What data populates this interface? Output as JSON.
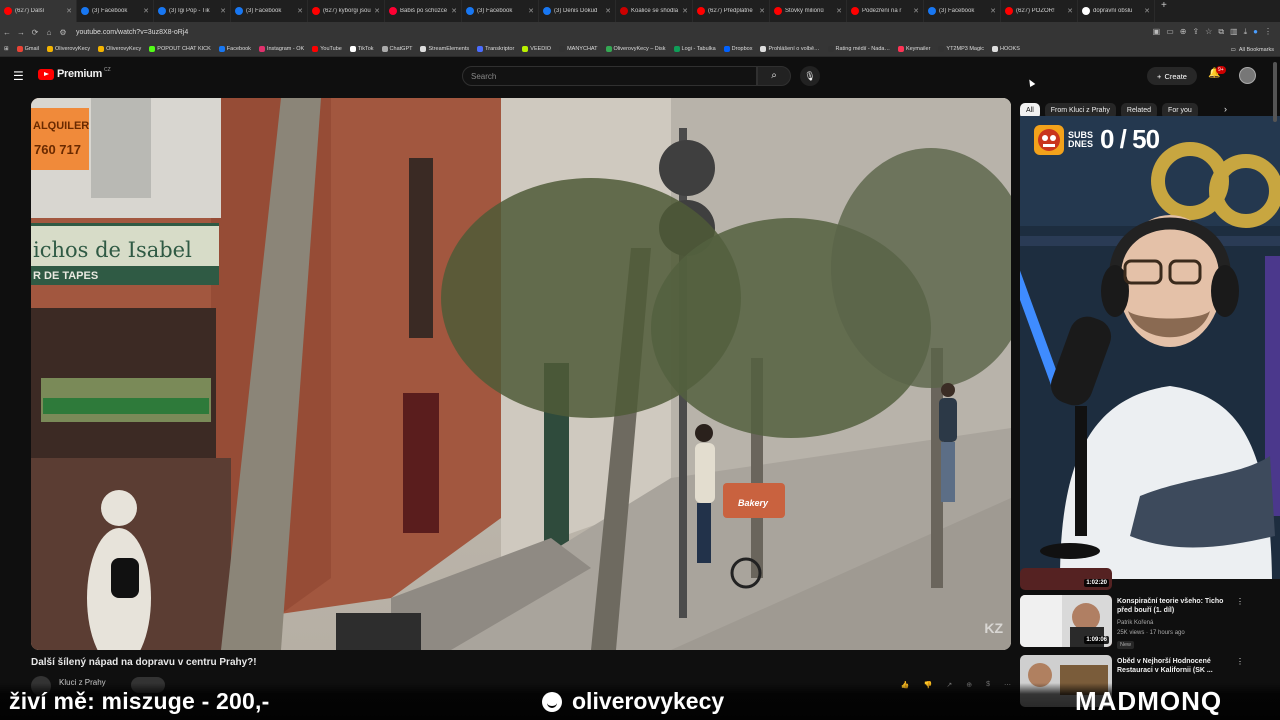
{
  "browser": {
    "tabs": [
      {
        "label": "(627) Další",
        "color": "#ff0000",
        "active": true
      },
      {
        "label": "(3) Facebook",
        "color": "#1877f2"
      },
      {
        "label": "(3) Igi Pop - Tik",
        "color": "#1877f2"
      },
      {
        "label": "(3) Facebook",
        "color": "#1877f2"
      },
      {
        "label": "(627) kyborgi jsou",
        "color": "#ff0000"
      },
      {
        "label": "Babiš po schůzce",
        "color": "#ff0033"
      },
      {
        "label": "(3) Facebook",
        "color": "#1877f2"
      },
      {
        "label": "(3) Denis Dokud",
        "color": "#1877f2"
      },
      {
        "label": "Koalice se shodla",
        "color": "#cc0000"
      },
      {
        "label": "(627) Předplatné",
        "color": "#ff0000"
      },
      {
        "label": "Stovky milionů",
        "color": "#ff0000"
      },
      {
        "label": "Podezření na r",
        "color": "#ff0000"
      },
      {
        "label": "(3) Facebook",
        "color": "#1877f2"
      },
      {
        "label": "(627) POZOR!",
        "color": "#ff0000"
      },
      {
        "label": "dopravní obslu",
        "color": "#ffffff"
      }
    ],
    "url": "youtube.com/watch?v=3uz8X8-oRj4",
    "bookmarks": [
      {
        "label": "Gmail",
        "color": "#ea4335"
      },
      {
        "label": "OliverovyKecy",
        "color": "#f4b400"
      },
      {
        "label": "OliverovyKecy",
        "color": "#f4b400"
      },
      {
        "label": "POPOUT CHAT KICK",
        "color": "#53fc18"
      },
      {
        "label": "Facebook",
        "color": "#1877f2"
      },
      {
        "label": "Instagram - OK",
        "color": "#e1306c"
      },
      {
        "label": "YouTube",
        "color": "#ff0000"
      },
      {
        "label": "TikTok",
        "color": "#ffffff"
      },
      {
        "label": "ChatGPT",
        "color": "#aaaaaa"
      },
      {
        "label": "StreamElements",
        "color": "#dddddd"
      },
      {
        "label": "Transkriptor",
        "color": "#4a6cff"
      },
      {
        "label": "VEEDIO",
        "color": "#b9f000"
      },
      {
        "label": "MANYCHAT",
        "color": "#333333"
      },
      {
        "label": "OliverovyKecy – Disk",
        "color": "#34a853"
      },
      {
        "label": "Logi - Tabulka",
        "color": "#0f9d58"
      },
      {
        "label": "Dropbox",
        "color": "#0061ff"
      },
      {
        "label": "Prohlášení o volbě…",
        "color": "#dddddd"
      },
      {
        "label": "Rating médií - Nada…",
        "color": "#333333"
      },
      {
        "label": "Keymailer",
        "color": "#ff3355"
      },
      {
        "label": "YT2MP3 Magic",
        "color": "#333333"
      },
      {
        "label": "HOOKS",
        "color": "#dddddd"
      }
    ],
    "all_bookmarks": "All Bookmarks"
  },
  "youtube": {
    "logo_text": "Premium",
    "country_code": "CZ",
    "search_placeholder": "Search",
    "create_label": "Create",
    "notification_badge": "9+"
  },
  "video": {
    "title": "Další šílený nápad na dopravu v centru Prahy?!",
    "channel": "Kluci z Prahy",
    "storefront_text": "ichos de Isabel",
    "storefront_sub": "R DE TAPES",
    "alquiler": "ALQUILER",
    "phone": "760 717",
    "bakery_sign": "Bakery",
    "watermark": "KZ"
  },
  "sidebar": {
    "chips": [
      {
        "label": "All",
        "active": true
      },
      {
        "label": "From Kluci z Prahy",
        "active": false
      },
      {
        "label": "Related",
        "active": false
      },
      {
        "label": "For you",
        "active": false
      }
    ],
    "subs_label_1": "SUBS",
    "subs_label_2": "DNES",
    "subs_count": "0 / 50",
    "suggestions": [
      {
        "title": "Konspirační teorie všeho: Ticho před bouří (1. díl)",
        "channel": "Patrik Kořená",
        "views": "25K views · 17 hours ago",
        "badge": "New",
        "duration": "1:09:06"
      },
      {
        "title": "Oběd v Nejhorší Hodnocené Restauraci v Kalifornii (SK ...",
        "channel": "",
        "views": "",
        "badge": "",
        "duration": ""
      }
    ],
    "partial_duration": "1:02:20"
  },
  "overlay": {
    "left_text": "živí mě: miszuge - 200,-",
    "middle_text": "oliverovykecy",
    "right_text": "MADMONQ"
  }
}
